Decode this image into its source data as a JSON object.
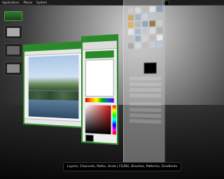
{
  "panel": {
    "menu": [
      "Applications",
      "Places",
      "System"
    ],
    "clock": ""
  },
  "dock": {
    "items": [
      "drive",
      "window-1",
      "window-2",
      "window-3"
    ]
  },
  "toolbox": {
    "tool_colors": [
      "#c9c9c9",
      "#d8d8d8",
      "#bdbdbd",
      "#e0e0e0",
      "#8aa0b8",
      "#caa96a",
      "#9fb6c9",
      "#d0d0d0",
      "#b8c7d8",
      "#c0c0c0",
      "#d7b56d",
      "#b8b8b8",
      "#8fa7c2",
      "#9a7a4a",
      "#cccccc",
      "#e2e2e2",
      "#a8bcd0",
      "#c8c8c8",
      "#d9d9d9",
      "#b0b0b0",
      "#c4c4c4",
      "#9ab1c6",
      "#d1d1d1",
      "#bdbdbd",
      "#e6e6e6",
      "#a9a9a9",
      "#d5d5d5",
      "#bfbfbf",
      "#cacaca",
      "#b7c8d9"
    ]
  },
  "tooltip": {
    "text": "Layers, Channels, Paths, Undo | FG/BG, Brushes, Patterns, Gradients"
  },
  "colors": {
    "accent": "#2a8a2a",
    "panel": "#1c1c1c"
  }
}
